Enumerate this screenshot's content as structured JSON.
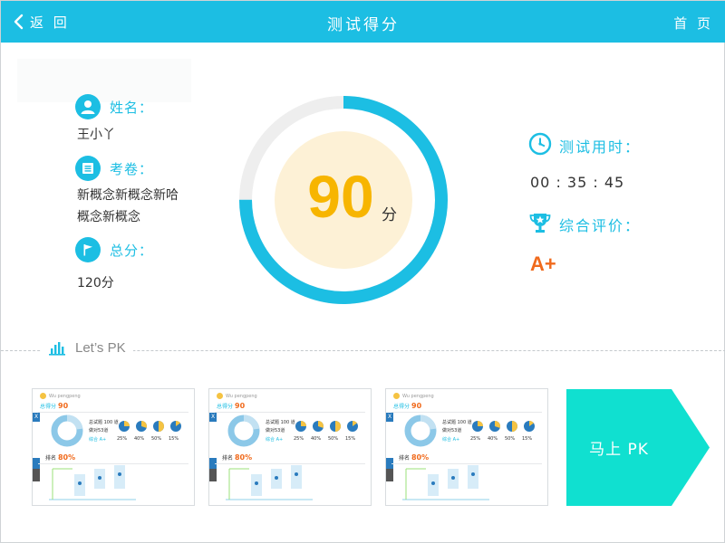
{
  "header": {
    "back_label": "返 回",
    "title": "测试得分",
    "home_label": "首 页"
  },
  "student": {
    "name_label": "姓名：",
    "name_value": "王小丫",
    "paper_label": "考卷：",
    "paper_value_line1": "新概念新概念新哈",
    "paper_value_line2": "概念新概念",
    "total_label": "总分：",
    "total_value": "120分"
  },
  "score": {
    "value": "90",
    "unit": "分",
    "fraction": 0.75
  },
  "result": {
    "time_label": "测试用时：",
    "time_value": "00 : 35 : 45",
    "grade_label": "综合评价：",
    "grade_value": "A+"
  },
  "pk": {
    "section_label": "Let’s PK",
    "button_label": "马上 PK",
    "cards": [
      {
        "user": "Wu pengpeng",
        "total_label": "总得分",
        "total_value": "90",
        "stat1": "总试题 100 道",
        "stat2": "做对53道",
        "stat3": "综合 A+",
        "percents": [
          "25%",
          "40%",
          "50%",
          "15%"
        ],
        "rank_label": "排名",
        "rank_value": "80%"
      },
      {
        "user": "Wu pengpeng",
        "total_label": "总得分",
        "total_value": "90",
        "stat1": "总试题 100 道",
        "stat2": "做对53道",
        "stat3": "综合 A+",
        "percents": [
          "25%",
          "40%",
          "50%",
          "15%"
        ],
        "rank_label": "排名",
        "rank_value": "80%"
      },
      {
        "user": "Wu pengpeng",
        "total_label": "总得分",
        "total_value": "90",
        "stat1": "总试题 100 道",
        "stat2": "做对53道",
        "stat3": "综合 A+",
        "percents": [
          "25%",
          "40%",
          "50%",
          "15%"
        ],
        "rank_label": "排名",
        "rank_value": "80%"
      }
    ]
  },
  "colors": {
    "primary": "#1cbee3",
    "score": "#f7b500",
    "grade": "#f06a1c",
    "pk_button": "#10e0d0",
    "ring_track": "#eeeeee",
    "ring_inner": "#fdf1d6"
  }
}
